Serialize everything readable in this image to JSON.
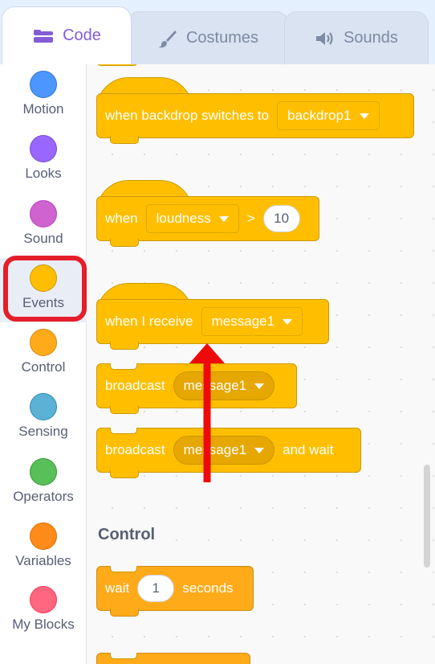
{
  "tabs": {
    "code": "Code",
    "costumes": "Costumes",
    "sounds": "Sounds"
  },
  "categories": [
    {
      "label": "Motion",
      "color": "#4c97ff",
      "border": "#3373cc"
    },
    {
      "label": "Looks",
      "color": "#9966ff",
      "border": "#774dcb"
    },
    {
      "label": "Sound",
      "color": "#cf63cf",
      "border": "#bd42bd"
    },
    {
      "label": "Events",
      "color": "#ffbf00",
      "border": "#cc9900"
    },
    {
      "label": "Control",
      "color": "#ffab19",
      "border": "#cf8b17"
    },
    {
      "label": "Sensing",
      "color": "#5cb1d6",
      "border": "#2e8eb8"
    },
    {
      "label": "Operators",
      "color": "#59c059",
      "border": "#389438"
    },
    {
      "label": "Variables",
      "color": "#ff8c1a",
      "border": "#db6e00"
    },
    {
      "label": "My Blocks",
      "color": "#ff6680",
      "border": "#ff3355"
    }
  ],
  "blocks": {
    "backdrop_switch": {
      "text": "when backdrop switches to",
      "menu": "backdrop1"
    },
    "loudness": {
      "when": "when",
      "menu": "loudness",
      "op": ">",
      "value": "10"
    },
    "receive": {
      "text": "when I receive",
      "menu": "message1"
    },
    "broadcast": {
      "text": "broadcast",
      "menu": "message1"
    },
    "broadcast_wait": {
      "text": "broadcast",
      "menu": "message1",
      "suffix": "and wait"
    },
    "wait": {
      "text": "wait",
      "value": "1",
      "suffix": "seconds"
    }
  },
  "sections": {
    "control": "Control"
  },
  "colors": {
    "events": "#ffbf00",
    "highlight": "#e41e2a",
    "accent": "#855cd6"
  }
}
